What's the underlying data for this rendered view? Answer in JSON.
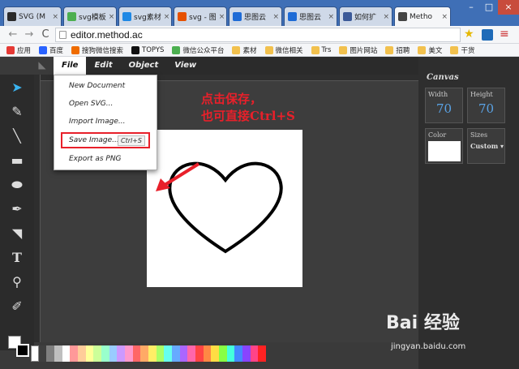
{
  "tabs": [
    {
      "label": "SVG (M",
      "favicon_color": "#2b2b2b"
    },
    {
      "label": "svg模板",
      "favicon_color": "#4caf50"
    },
    {
      "label": "svg素材",
      "favicon_color": "#1e88e5"
    },
    {
      "label": "svg - 图",
      "favicon_color": "#e65100"
    },
    {
      "label": "思图云",
      "favicon_color": "#1e6bd6"
    },
    {
      "label": "思图云",
      "favicon_color": "#1e6bd6"
    },
    {
      "label": "如何扩",
      "favicon_color": "#3b5998"
    },
    {
      "label": "Metho",
      "favicon_color": "#444444"
    }
  ],
  "address_bar": {
    "url": "editor.method.ac"
  },
  "bookmarks": [
    {
      "label": "应用",
      "color": "#e53935"
    },
    {
      "label": "百度",
      "color": "#2962ff"
    },
    {
      "label": "搜狗微信搜索",
      "color": "#ef6c00"
    },
    {
      "label": "TOPYS",
      "color": "#111111"
    },
    {
      "label": "微信公众平台",
      "color": "#4caf50"
    },
    {
      "label": "素材",
      "color": "#f2c14e"
    },
    {
      "label": "微信相关",
      "color": "#f2c14e"
    },
    {
      "label": "Trs",
      "color": "#f2c14e"
    },
    {
      "label": "图片网站",
      "color": "#f2c14e"
    },
    {
      "label": "招聘",
      "color": "#f2c14e"
    },
    {
      "label": "美文",
      "color": "#f2c14e"
    },
    {
      "label": "干货",
      "color": "#f2c14e"
    }
  ],
  "menubar": {
    "file": "File",
    "edit": "Edit",
    "object": "Object",
    "view": "View"
  },
  "file_menu": {
    "new_document": "New Document",
    "open_svg": "Open SVG...",
    "import_image": "Import Image...",
    "save_image": "Save Image...",
    "save_shortcut": "Ctrl+S",
    "export_png": "Export as PNG"
  },
  "canvas_panel": {
    "title": "Canvas",
    "width_label": "Width",
    "width_value": "70",
    "height_label": "Height",
    "height_value": "70",
    "color_label": "Color",
    "color_value": "#ffffff",
    "sizes_label": "Sizes",
    "sizes_value": "Custom"
  },
  "annotation": {
    "text": "点击保存，\n也可直接Ctrl+S",
    "color": "#e8202a"
  },
  "watermark": {
    "logo": "Bai 经验",
    "url": "jingyan.baidu.com"
  },
  "palette": [
    "#000000",
    "#3f3f3f",
    "#7f7f7f",
    "#bfbfbf",
    "#ffffff",
    "#ff9999",
    "#ffcc99",
    "#ffff99",
    "#ccff99",
    "#99ffcc",
    "#99ccff",
    "#cc99ff",
    "#ff99cc",
    "#ff6666",
    "#ffaa66",
    "#ffee66",
    "#aaff66",
    "#66ffee",
    "#66aaff",
    "#aa66ff",
    "#ff66aa",
    "#ff4444",
    "#ff8844",
    "#ffdd44",
    "#88ff44",
    "#44ffdd",
    "#4488ff",
    "#8844ff",
    "#ff4488",
    "#ff2222"
  ]
}
